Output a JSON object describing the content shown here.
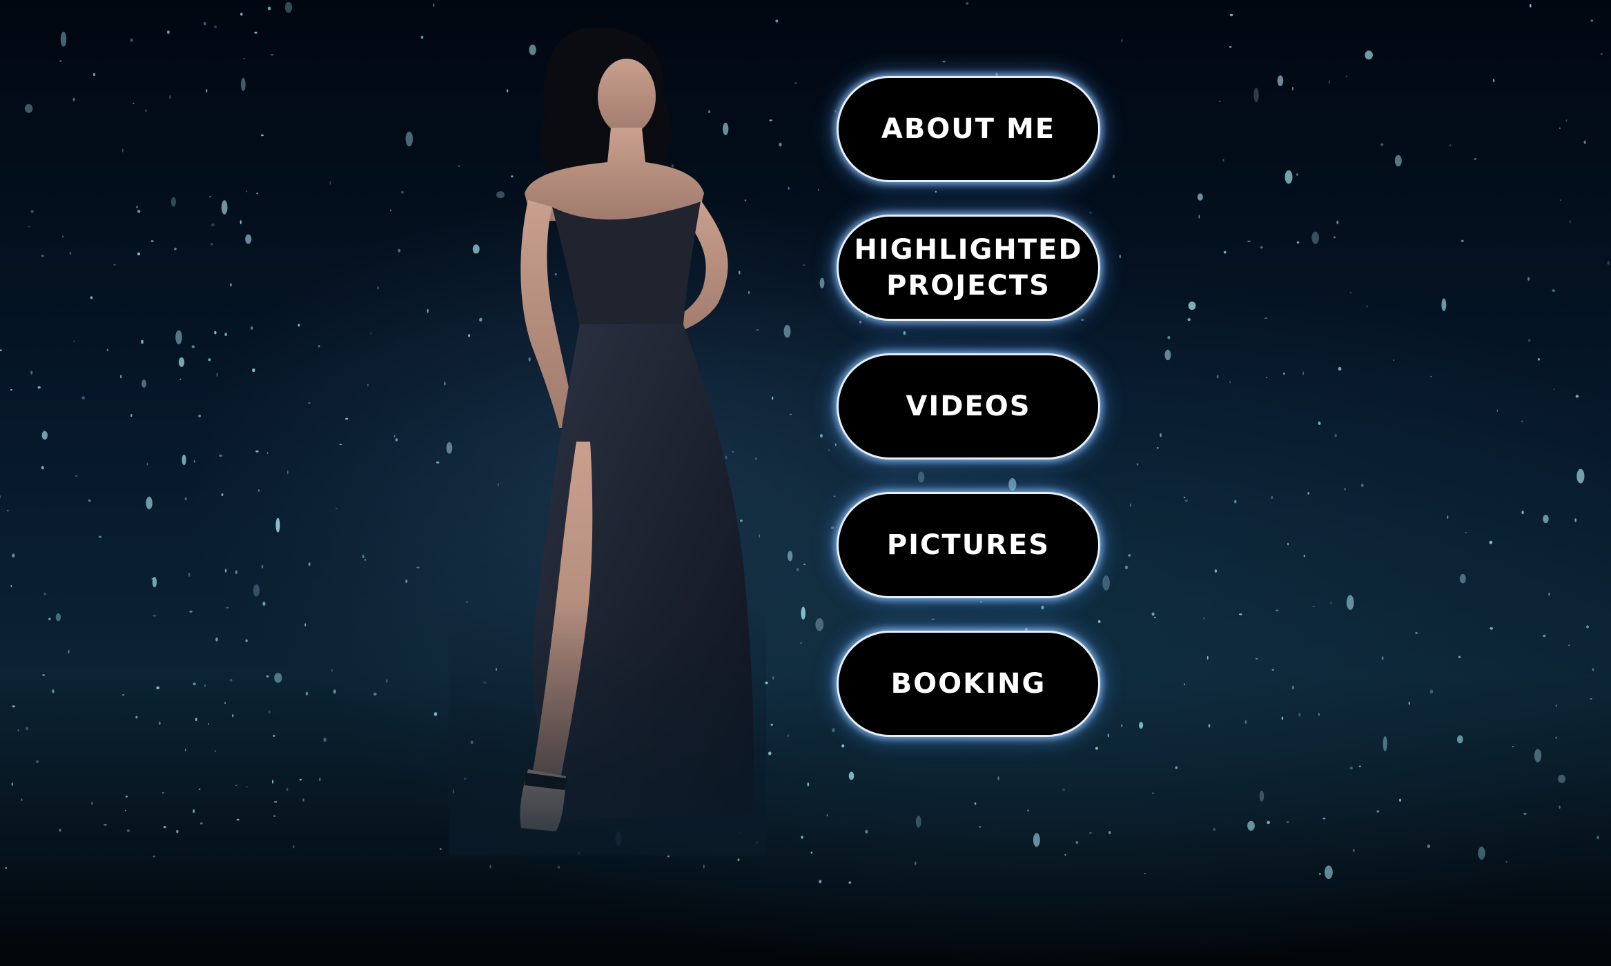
{
  "menu": {
    "items": [
      {
        "id": "about",
        "lines": [
          "ABOUT ME"
        ]
      },
      {
        "id": "projects",
        "lines": [
          "HIGHLIGHTED",
          "PROJECTS"
        ]
      },
      {
        "id": "videos",
        "lines": [
          "VIDEOS"
        ]
      },
      {
        "id": "pictures",
        "lines": [
          "PICTURES"
        ]
      },
      {
        "id": "booking",
        "lines": [
          "BOOKING"
        ]
      }
    ]
  },
  "colors": {
    "background": "#020814",
    "button_fill": "#000000",
    "button_border": "#e8eef6",
    "button_glow": "#82bdf5",
    "button_text": "#ffffff",
    "particle": "#9fd9e6"
  }
}
